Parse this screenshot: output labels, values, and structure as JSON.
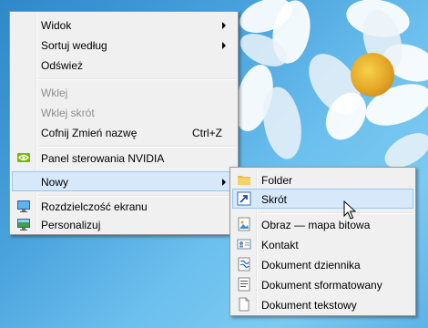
{
  "context_menu": {
    "items": [
      {
        "label": "Widok",
        "has_submenu": true
      },
      {
        "label": "Sortuj według",
        "has_submenu": true
      },
      {
        "label": "Odśwież"
      },
      {
        "label": "Wklej",
        "disabled": true
      },
      {
        "label": "Wklej skrót",
        "disabled": true
      },
      {
        "label": "Cofnij Zmień nazwę",
        "shortcut": "Ctrl+Z"
      },
      {
        "label": "Panel sterowania NVIDIA",
        "icon": "nvidia-icon"
      },
      {
        "label": "Nowy",
        "has_submenu": true,
        "highlighted": true
      },
      {
        "label": "Rozdzielczość ekranu",
        "icon": "monitor-icon"
      },
      {
        "label": "Personalizuj",
        "icon": "personalize-icon"
      }
    ]
  },
  "submenu": {
    "items": [
      {
        "label": "Folder",
        "icon": "folder-icon"
      },
      {
        "label": "Skrót",
        "icon": "shortcut-icon",
        "highlighted": true
      },
      {
        "label": "Obraz — mapa bitowa",
        "icon": "bitmap-icon"
      },
      {
        "label": "Kontakt",
        "icon": "contact-icon"
      },
      {
        "label": "Dokument dziennika",
        "icon": "journal-icon"
      },
      {
        "label": "Dokument sformatowany",
        "icon": "rtf-icon"
      },
      {
        "label": "Dokument tekstowy",
        "icon": "text-doc-icon"
      }
    ]
  },
  "colors": {
    "highlight_bg": "#d6e8f9",
    "highlight_border": "#99c8f0",
    "menu_bg": "#f0f0f0",
    "desktop_blue": "#4aa3dd"
  }
}
